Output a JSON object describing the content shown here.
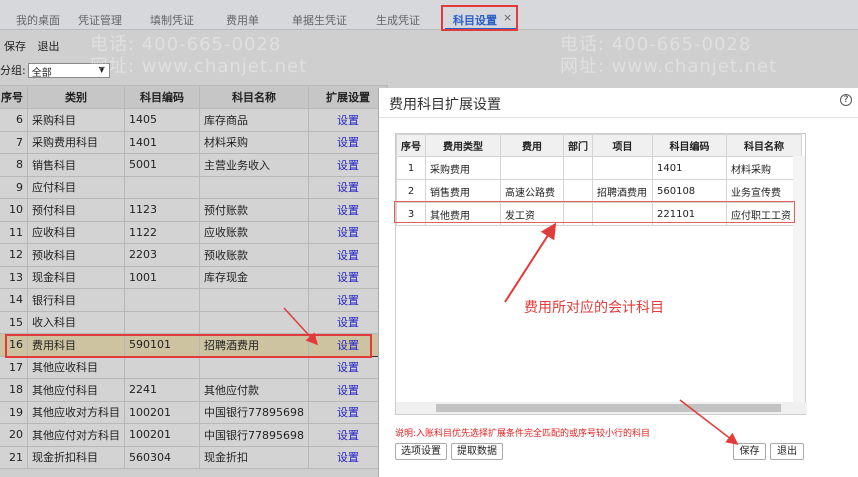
{
  "tabs": [
    "我的桌面",
    "凭证管理",
    "填制凭证",
    "费用单",
    "单据生凭证",
    "生成凭证",
    "科目设置"
  ],
  "tab_close": "×",
  "toolbar": {
    "save": "保存",
    "exit": "退出"
  },
  "group": {
    "label": "分组:",
    "value": "全部"
  },
  "main_table": {
    "headers": [
      "序号",
      "类别",
      "科目编码",
      "科目名称",
      "扩展设置"
    ],
    "rows": [
      [
        "6",
        "采购科目",
        "1405",
        "库存商品",
        "设置"
      ],
      [
        "7",
        "采购费用科目",
        "1401",
        "材料采购",
        "设置"
      ],
      [
        "8",
        "销售科目",
        "5001",
        "主营业务收入",
        "设置"
      ],
      [
        "9",
        "应付科目",
        "",
        "",
        "设置"
      ],
      [
        "10",
        "预付科目",
        "1123",
        "预付账款",
        "设置"
      ],
      [
        "11",
        "应收科目",
        "1122",
        "应收账款",
        "设置"
      ],
      [
        "12",
        "预收科目",
        "2203",
        "预收账款",
        "设置"
      ],
      [
        "13",
        "现金科目",
        "1001",
        "库存现金",
        "设置"
      ],
      [
        "14",
        "银行科目",
        "",
        "",
        "设置"
      ],
      [
        "15",
        "收入科目",
        "",
        "",
        "设置"
      ],
      [
        "16",
        "费用科目",
        "590101",
        "招聘酒费用",
        "设置"
      ],
      [
        "17",
        "其他应收科目",
        "",
        "",
        "设置"
      ],
      [
        "18",
        "其他应付科目",
        "2241",
        "其他应付款",
        "设置"
      ],
      [
        "19",
        "其他应收对方科目",
        "100201",
        "中国银行77895698",
        "设置"
      ],
      [
        "20",
        "其他应付对方科目",
        "100201",
        "中国银行77895698",
        "设置"
      ],
      [
        "21",
        "现金折扣科目",
        "560304",
        "现金折扣",
        "设置"
      ]
    ]
  },
  "dialog": {
    "title": "费用科目扩展设置",
    "help": "?",
    "headers": [
      "序号",
      "费用类型",
      "费用",
      "部门",
      "项目",
      "科目编码",
      "科目名称"
    ],
    "rows": [
      [
        "1",
        "采购费用",
        "",
        "",
        "",
        "1401",
        "材料采购"
      ],
      [
        "2",
        "销售费用",
        "高速公路费",
        "",
        "招聘酒费用",
        "560108",
        "业务宣传费"
      ],
      [
        "3",
        "其他费用",
        "发工资",
        "",
        "",
        "221101",
        "应付职工工资"
      ]
    ],
    "note": "说明:入账科目优先选择扩展条件完全匹配的或序号较小行的科目",
    "buttons": {
      "options": "选项设置",
      "fetch": "提取数据",
      "save": "保存",
      "exit": "退出"
    }
  },
  "annotation": "费用所对应的会计科目",
  "watermark": {
    "phone": "电话: 400-665-0028",
    "site": "网址: www.chanjet.net"
  },
  "colors": {
    "accent": "#2a5fc7",
    "highlight": "#e23b3b",
    "link": "#2323c8"
  }
}
